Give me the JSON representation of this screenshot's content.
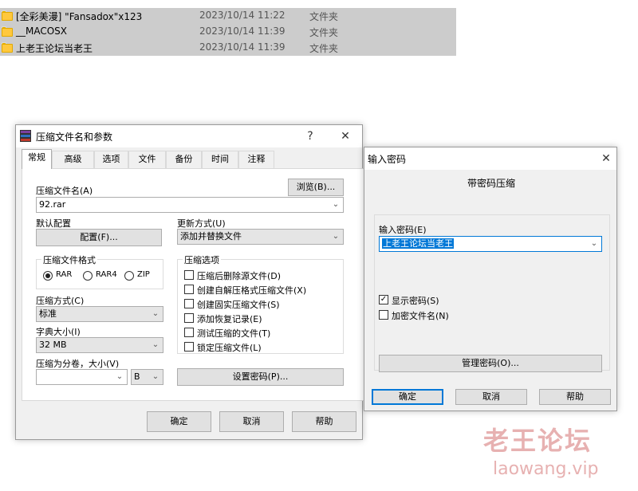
{
  "files": [
    {
      "name": "[全彩美漫] \"Fansadox\"x123",
      "date": "2023/10/14 11:22",
      "type": "文件夹"
    },
    {
      "name": "__MACOSX",
      "date": "2023/10/14 11:39",
      "type": "文件夹"
    },
    {
      "name": "上老王论坛当老王",
      "date": "2023/10/14 11:39",
      "type": "文件夹"
    }
  ],
  "main_dialog": {
    "title": "压缩文件名和参数",
    "help_glyph": "?",
    "close_glyph": "✕",
    "tabs": [
      "常规",
      "高级",
      "选项",
      "文件",
      "备份",
      "时间",
      "注释"
    ],
    "archive_name_label": "压缩文件名(A)",
    "browse_label": "浏览(B)...",
    "archive_name_value": "92.rar",
    "default_profile_label": "默认配置",
    "profiles_button": "配置(F)...",
    "update_mode_label": "更新方式(U)",
    "update_mode_value": "添加并替换文件",
    "format_group_title": "压缩文件格式",
    "formats": [
      "RAR",
      "RAR4",
      "ZIP"
    ],
    "selected_format": "RAR",
    "options_group_title": "压缩选项",
    "options": [
      {
        "label": "压缩后删除源文件(D)",
        "checked": false
      },
      {
        "label": "创建自解压格式压缩文件(X)",
        "checked": false
      },
      {
        "label": "创建固实压缩文件(S)",
        "checked": false
      },
      {
        "label": "添加恢复记录(E)",
        "checked": false
      },
      {
        "label": "测试压缩的文件(T)",
        "checked": false
      },
      {
        "label": "锁定压缩文件(L)",
        "checked": false
      }
    ],
    "method_label": "压缩方式(C)",
    "method_value": "标准",
    "dict_label": "字典大小(I)",
    "dict_value": "32 MB",
    "split_label": "压缩为分卷，大小(V)",
    "split_value": "",
    "split_unit": "B",
    "set_password_button": "设置密码(P)...",
    "ok_button": "确定",
    "cancel_button": "取消",
    "help_button": "帮助"
  },
  "password_dialog": {
    "title": "输入密码",
    "close_glyph": "✕",
    "subtitle": "带密码压缩",
    "password_label": "输入密码(E)",
    "password_value": "上老王论坛当老王",
    "show_password_label": "显示密码(S)",
    "show_password_checked": true,
    "encrypt_names_label": "加密文件名(N)",
    "encrypt_names_checked": false,
    "organize_button": "管理密码(O)...",
    "ok_button": "确定",
    "cancel_button": "取消",
    "help_button": "帮助"
  },
  "watermark": {
    "cn": "老王论坛",
    "url": "laowang.vip"
  },
  "colors": {
    "selection_bg": "#cccccc",
    "folder": "#ffc83d",
    "focus_blue": "#0078d7",
    "watermark": "#e7b1b1"
  },
  "icons": {
    "folder": "folder-icon",
    "winrar": "winrar-icon",
    "dropdown": "chevron-down-icon"
  }
}
